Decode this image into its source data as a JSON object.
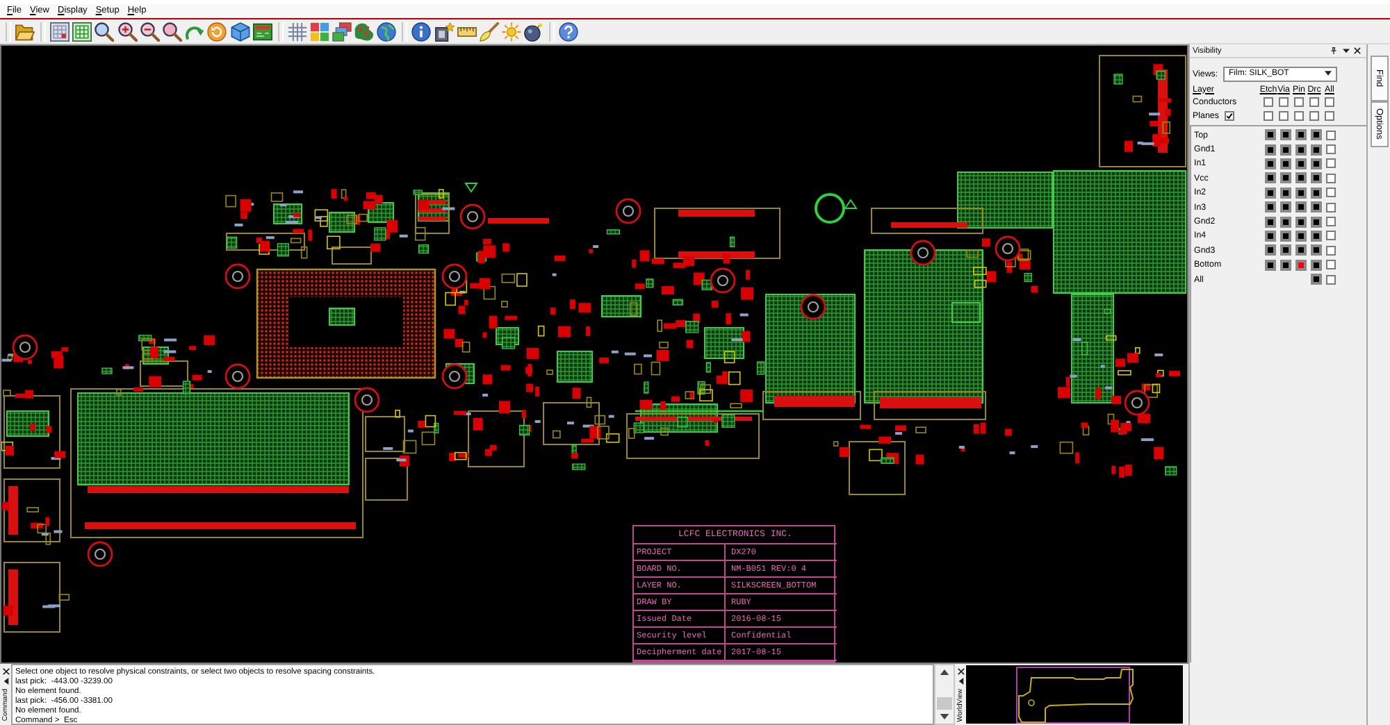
{
  "menu": [
    {
      "label": "File"
    },
    {
      "label": "View"
    },
    {
      "label": "Display"
    },
    {
      "label": "Setup"
    },
    {
      "label": "Help"
    }
  ],
  "title_block": {
    "heading": "LCFC ELECTRONICS INC.",
    "rows": [
      {
        "label": "PROJECT",
        "value": "DX270"
      },
      {
        "label": "BOARD NO.",
        "value": "NM-B051 REV:0 4"
      },
      {
        "label": "LAYER NO.",
        "value": "SILKSCREEN_BOTTOM"
      },
      {
        "label": "DRAW BY",
        "value": "RUBY"
      },
      {
        "label": "Issued Date",
        "value": "2016-08-15"
      },
      {
        "label": "Security level",
        "value": "Confidential"
      },
      {
        "label": "Decipherment date",
        "value": "2017-08-15"
      }
    ]
  },
  "console": {
    "tab_label": "Command",
    "lines": [
      "Select one object to resolve physical constraints, or select two objects to resolve spacing constraints.",
      "last pick:  -443.00 -3239.00",
      "No element found.",
      "last pick:  -456.00 -3381.00",
      "No element found.",
      "Command >  Esc"
    ]
  },
  "world_view": {
    "tab_label": "WorldView"
  },
  "visibility": {
    "title": "Visibility",
    "views_label": "Views:",
    "views_value": "Film: SILK_BOT",
    "columns": [
      "Layer",
      "Etch",
      "Via",
      "Pin",
      "Drc",
      "All"
    ],
    "groups": [
      {
        "label": "Conductors",
        "checks": [
          false,
          false,
          false,
          false,
          false
        ]
      },
      {
        "label": "Planes",
        "checked": true,
        "checks": [
          false,
          false,
          false,
          false,
          false
        ]
      }
    ],
    "layers": [
      {
        "name": "Top",
        "etch": {
          "color": "#000000"
        },
        "via": {
          "color": "#000000"
        },
        "pin": {
          "color": "#000000"
        },
        "drc": {
          "color": "#000000"
        },
        "all": false
      },
      {
        "name": "Gnd1",
        "etch": {
          "color": "#000000"
        },
        "via": {
          "color": "#000000"
        },
        "pin": {
          "color": "#000000"
        },
        "drc": {
          "color": "#000000"
        },
        "all": false
      },
      {
        "name": "In1",
        "etch": {
          "color": "#000000"
        },
        "via": {
          "color": "#000000"
        },
        "pin": {
          "color": "#000000"
        },
        "drc": {
          "color": "#000000"
        },
        "all": false
      },
      {
        "name": "Vcc",
        "etch": {
          "color": "#000000"
        },
        "via": {
          "color": "#000000"
        },
        "pin": {
          "color": "#000000"
        },
        "drc": {
          "color": "#000000"
        },
        "all": false
      },
      {
        "name": "In2",
        "etch": {
          "color": "#000000"
        },
        "via": {
          "color": "#000000"
        },
        "pin": {
          "color": "#000000"
        },
        "drc": {
          "color": "#000000"
        },
        "all": false
      },
      {
        "name": "In3",
        "etch": {
          "color": "#000000"
        },
        "via": {
          "color": "#000000"
        },
        "pin": {
          "color": "#000000"
        },
        "drc": {
          "color": "#000000"
        },
        "all": false
      },
      {
        "name": "Gnd2",
        "etch": {
          "color": "#000000"
        },
        "via": {
          "color": "#000000"
        },
        "pin": {
          "color": "#000000"
        },
        "drc": {
          "color": "#000000"
        },
        "all": false
      },
      {
        "name": "In4",
        "etch": {
          "color": "#000000"
        },
        "via": {
          "color": "#000000"
        },
        "pin": {
          "color": "#000000"
        },
        "drc": {
          "color": "#000000"
        },
        "all": false
      },
      {
        "name": "Gnd3",
        "etch": {
          "color": "#000000"
        },
        "via": {
          "color": "#000000"
        },
        "pin": {
          "color": "#000000"
        },
        "drc": {
          "color": "#000000"
        },
        "all": false
      },
      {
        "name": "Bottom",
        "etch": {
          "color": "#000000"
        },
        "via": {
          "color": "#000000"
        },
        "pin": {
          "color": "#ff0000"
        },
        "drc": {
          "color": "#000000"
        },
        "all": false
      },
      {
        "name": "All",
        "drc": {
          "color": "#000000"
        },
        "all": false
      }
    ]
  },
  "side_tabs": [
    {
      "label": "Find"
    },
    {
      "label": "Options"
    }
  ]
}
